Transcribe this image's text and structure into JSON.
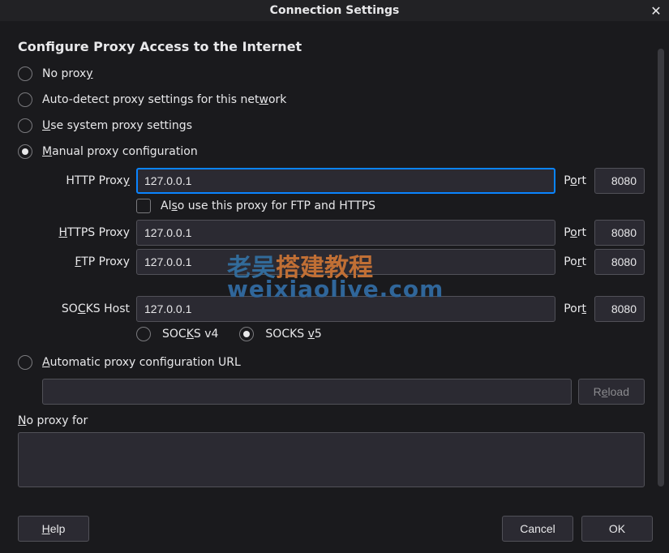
{
  "title": "Connection Settings",
  "heading": "Configure Proxy Access to the Internet",
  "options": {
    "no_proxy": {
      "pre": "No prox",
      "u": "y",
      "post": ""
    },
    "auto_detect": {
      "pre": "Auto-detect proxy settings for this net",
      "u": "w",
      "post": "ork"
    },
    "system": {
      "pre": "",
      "u": "U",
      "post": "se system proxy settings"
    },
    "manual": {
      "pre": "",
      "u": "M",
      "post": "anual proxy configuration"
    },
    "auto_url": {
      "pre": "",
      "u": "A",
      "post": "utomatic proxy configuration URL"
    }
  },
  "selected_option": "manual",
  "labels": {
    "http_proxy": {
      "pre": "HTTP Prox",
      "u": "y",
      "post": ""
    },
    "https_proxy": {
      "pre": "",
      "u": "H",
      "post": "TTPS Proxy"
    },
    "ftp_proxy": {
      "pre": "",
      "u": "F",
      "post": "TP Proxy"
    },
    "socks_host": {
      "pre": "SO",
      "u": "C",
      "post": "KS Host"
    },
    "port_o": {
      "pre": "P",
      "u": "o",
      "post": "rt"
    },
    "port_r": {
      "pre": "Po",
      "u": "r",
      "post": "t"
    },
    "port_t": {
      "pre": "Por",
      "u": "t",
      "post": ""
    },
    "also_use": {
      "pre": "Al",
      "u": "s",
      "post": "o use this proxy for FTP and HTTPS"
    },
    "socks4": {
      "pre": "SOC",
      "u": "K",
      "post": "S v4"
    },
    "socks5": {
      "pre": "SOCKS ",
      "u": "v",
      "post": "5"
    },
    "no_proxy_for": {
      "pre": "",
      "u": "N",
      "post": "o proxy for"
    },
    "reload": {
      "pre": "R",
      "u": "e",
      "post": "load"
    },
    "help": {
      "pre": "",
      "u": "H",
      "post": "elp"
    },
    "cancel": "Cancel",
    "ok": "OK"
  },
  "values": {
    "http_host": "127.0.0.1",
    "http_port": "8080",
    "https_host": "127.0.0.1",
    "https_port": "8080",
    "ftp_host": "127.0.0.1",
    "ftp_port": "8080",
    "socks_host": "127.0.0.1",
    "socks_port": "8080",
    "also_use_checked": false,
    "socks_version": "v5",
    "auto_url": "",
    "no_proxy_list": ""
  },
  "watermark": {
    "line1_left": "老吴",
    "line1_right": "搭建教程",
    "line2": "weixiaolive.com"
  }
}
